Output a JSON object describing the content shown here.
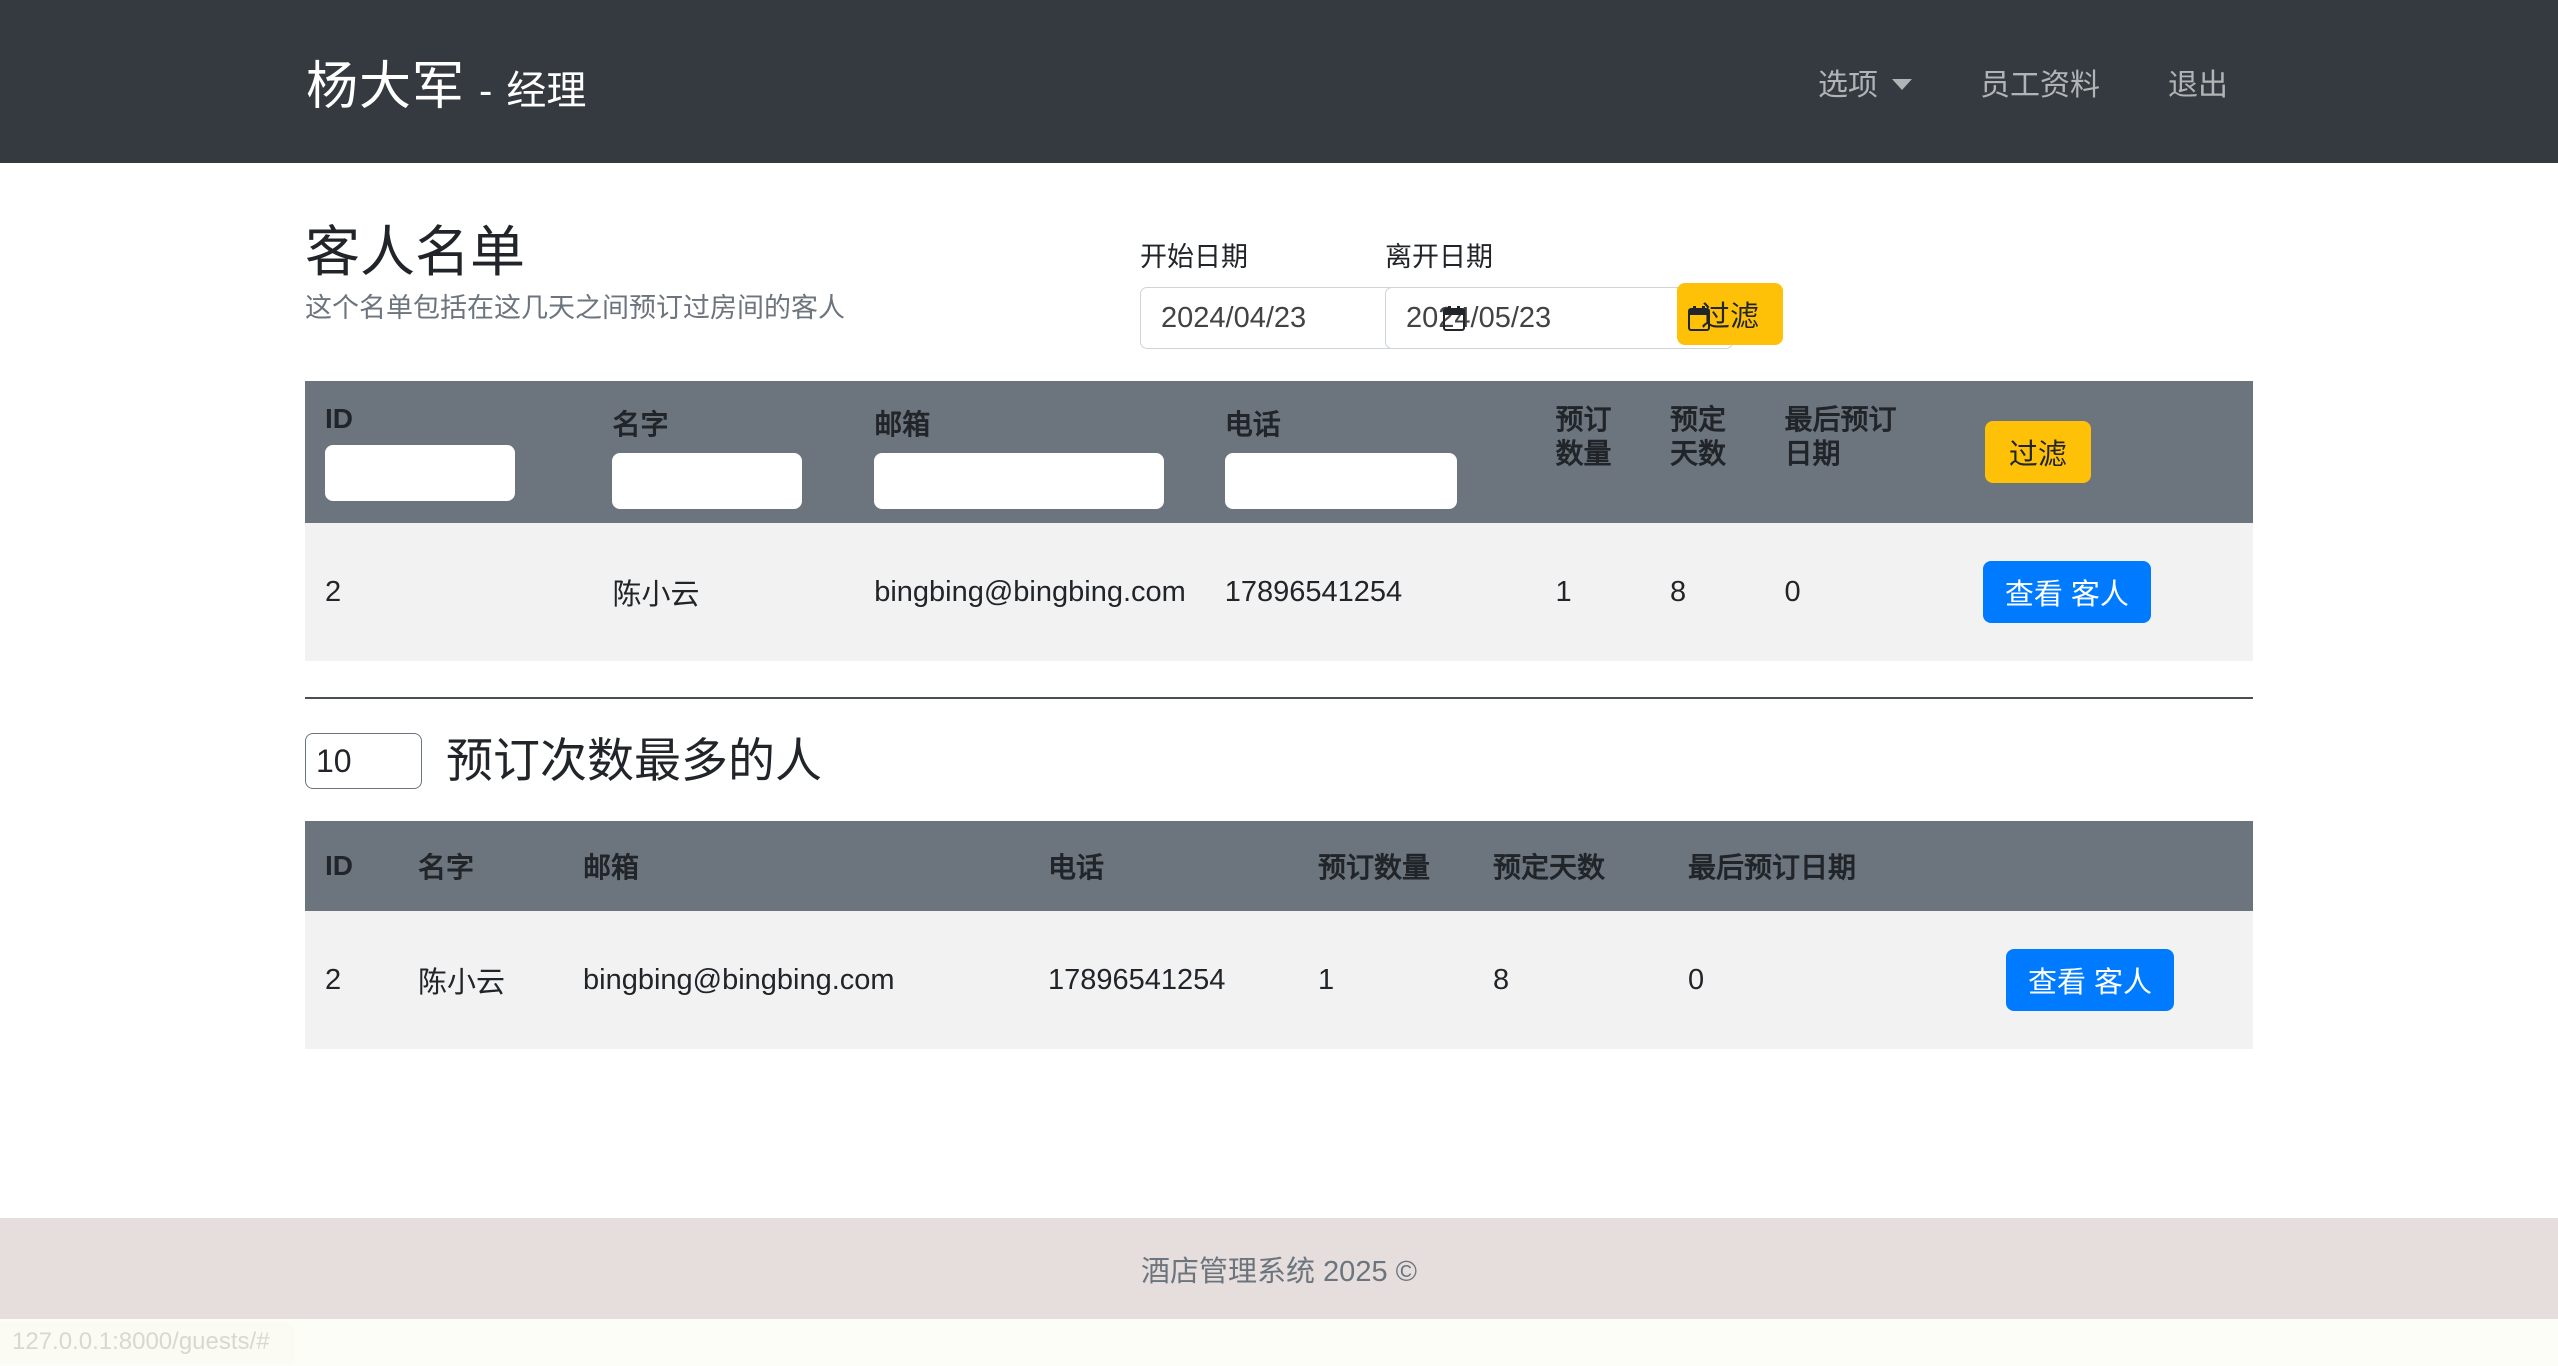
{
  "navbar": {
    "brand_name": "杨大军",
    "brand_sep": "-",
    "brand_role": "经理",
    "links": [
      {
        "label": "选项",
        "icon": "chevron-down-icon",
        "has_caret": true
      },
      {
        "label": "员工资料",
        "has_caret": false
      },
      {
        "label": "退出",
        "has_caret": false
      }
    ]
  },
  "page": {
    "title": "客人名单",
    "subtitle": "这个名单包括在这几天之间预订过房间的客人"
  },
  "date_filter": {
    "start_label": "开始日期",
    "start_value": "2024/04/23",
    "end_label": "离开日期",
    "end_value": "2024/05/23",
    "filter_button": "过滤"
  },
  "guests_table": {
    "columns": [
      {
        "label": "ID",
        "filter": true,
        "value": ""
      },
      {
        "label": "名字",
        "filter": true,
        "value": ""
      },
      {
        "label": "邮箱",
        "filter": true,
        "value": ""
      },
      {
        "label": "电话",
        "filter": true,
        "value": ""
      },
      {
        "label": "预订\n数量",
        "line1": "预订",
        "line2": "数量",
        "filter": false
      },
      {
        "label": "预定\n天数",
        "line1": "预定",
        "line2": "天数",
        "filter": false
      },
      {
        "label": "最后预订\n日期",
        "line1": "最后预订",
        "line2": "日期",
        "filter": false
      }
    ],
    "filter_button": "过滤",
    "rows": [
      {
        "id": "2",
        "name": "陈小云",
        "email": "bingbing@bingbing.com",
        "phone": "17896541254",
        "bookings": "1",
        "nights": "8",
        "last_booking": "0",
        "action": "查看 客人"
      }
    ]
  },
  "top_section": {
    "count_value": "10",
    "title": "预订次数最多的人",
    "columns": [
      "ID",
      "名字",
      "邮箱",
      "电话",
      "预订数量",
      "预定天数",
      "最后预订日期"
    ],
    "rows": [
      {
        "id": "2",
        "name": "陈小云",
        "email": "bingbing@bingbing.com",
        "phone": "17896541254",
        "bookings": "1",
        "nights": "8",
        "last_booking": "0",
        "action": "查看 客人"
      }
    ]
  },
  "footer": {
    "text": "酒店管理系统 2025 ©"
  },
  "statusbar": {
    "url": "127.0.0.1:8000/guests/#"
  },
  "colors": {
    "navbar_bg": "#343a40",
    "table_head_bg": "#6c757d",
    "warning": "#ffc107",
    "primary": "#007bff",
    "row_bg": "#f2f2f2",
    "footer_bg": "#e6dedd"
  }
}
